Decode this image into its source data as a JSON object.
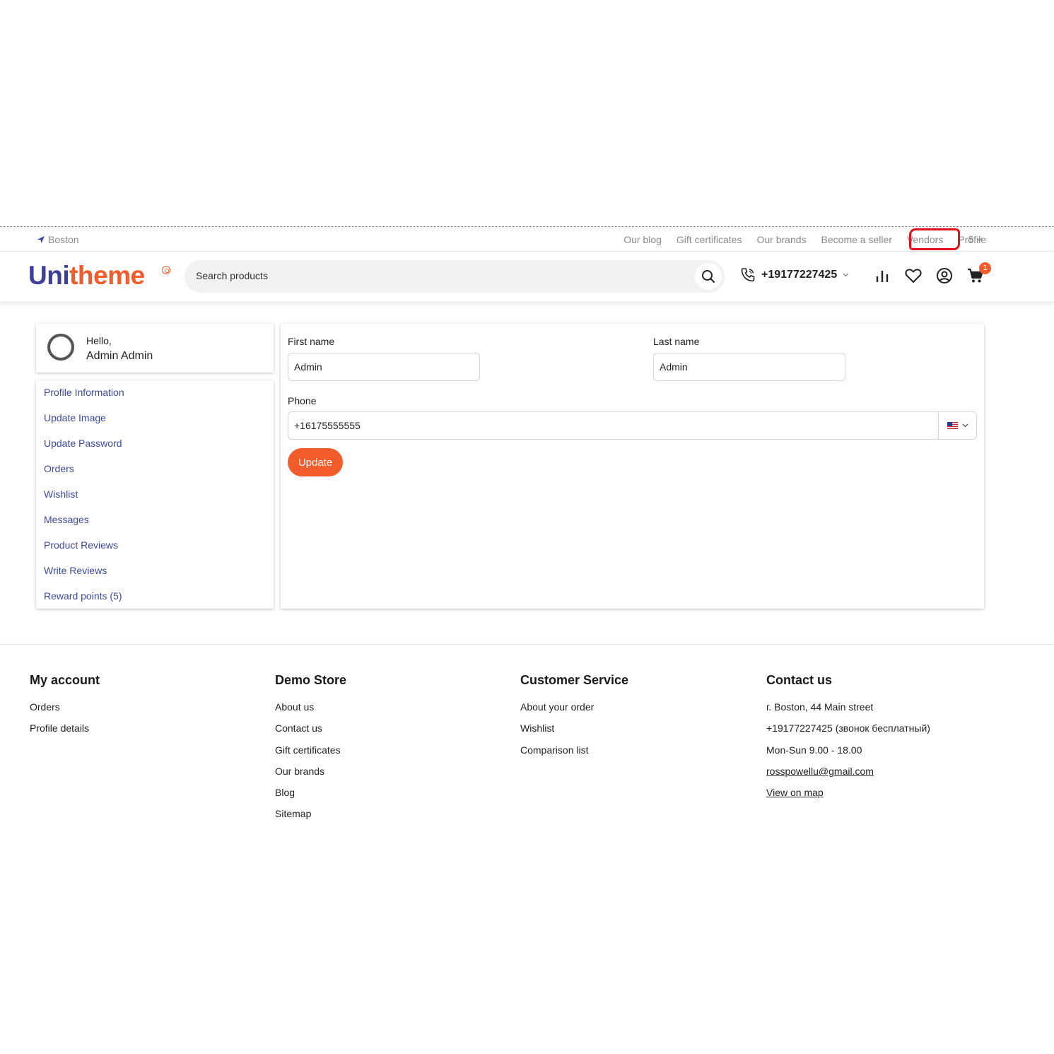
{
  "topbar": {
    "location": "Boston",
    "links": [
      "Our blog",
      "Gift certificates",
      "Our brands",
      "Become a seller",
      "Vendors",
      "Profile"
    ],
    "currency": "$"
  },
  "header": {
    "logo_part1": "Uni",
    "logo_part2": "theme",
    "search_placeholder": "Search products",
    "phone": "+19177227425",
    "cart_count": "1"
  },
  "sidebar": {
    "hello": "Hello,",
    "user_name": "Admin Admin",
    "items": [
      "Profile Information",
      "Update Image",
      "Update Password",
      "Orders",
      "Wishlist",
      "Messages",
      "Product Reviews",
      "Write Reviews",
      "Reward points (5)"
    ]
  },
  "form": {
    "first_name_label": "First name",
    "first_name_value": "Admin",
    "last_name_label": "Last name",
    "last_name_value": "Admin",
    "phone_label": "Phone",
    "phone_value": "+16175555555",
    "update_label": "Update"
  },
  "footer": {
    "my_account": {
      "title": "My account",
      "items": [
        "Orders",
        "Profile details"
      ]
    },
    "demo_store": {
      "title": "Demo Store",
      "items": [
        "About us",
        "Contact us",
        "Gift certificates",
        "Our brands",
        "Blog",
        "Sitemap"
      ]
    },
    "customer_service": {
      "title": "Customer Service",
      "items": [
        "About your order",
        "Wishlist",
        "Comparison list"
      ]
    },
    "contact_us": {
      "title": "Contact us",
      "address": "г. Boston, 44 Main street",
      "phone": "+19177227425 (звонок бесплатный)",
      "hours": "Mon-Sun 9.00 - 18.00",
      "email": "rosspowellu@gmail.com",
      "map": "View on map"
    }
  },
  "colors": {
    "brand_blue": "#3d3f9c",
    "brand_orange": "#f25c2a",
    "link_blue": "#3d4a9a",
    "annotation_red": "#e0101c"
  }
}
